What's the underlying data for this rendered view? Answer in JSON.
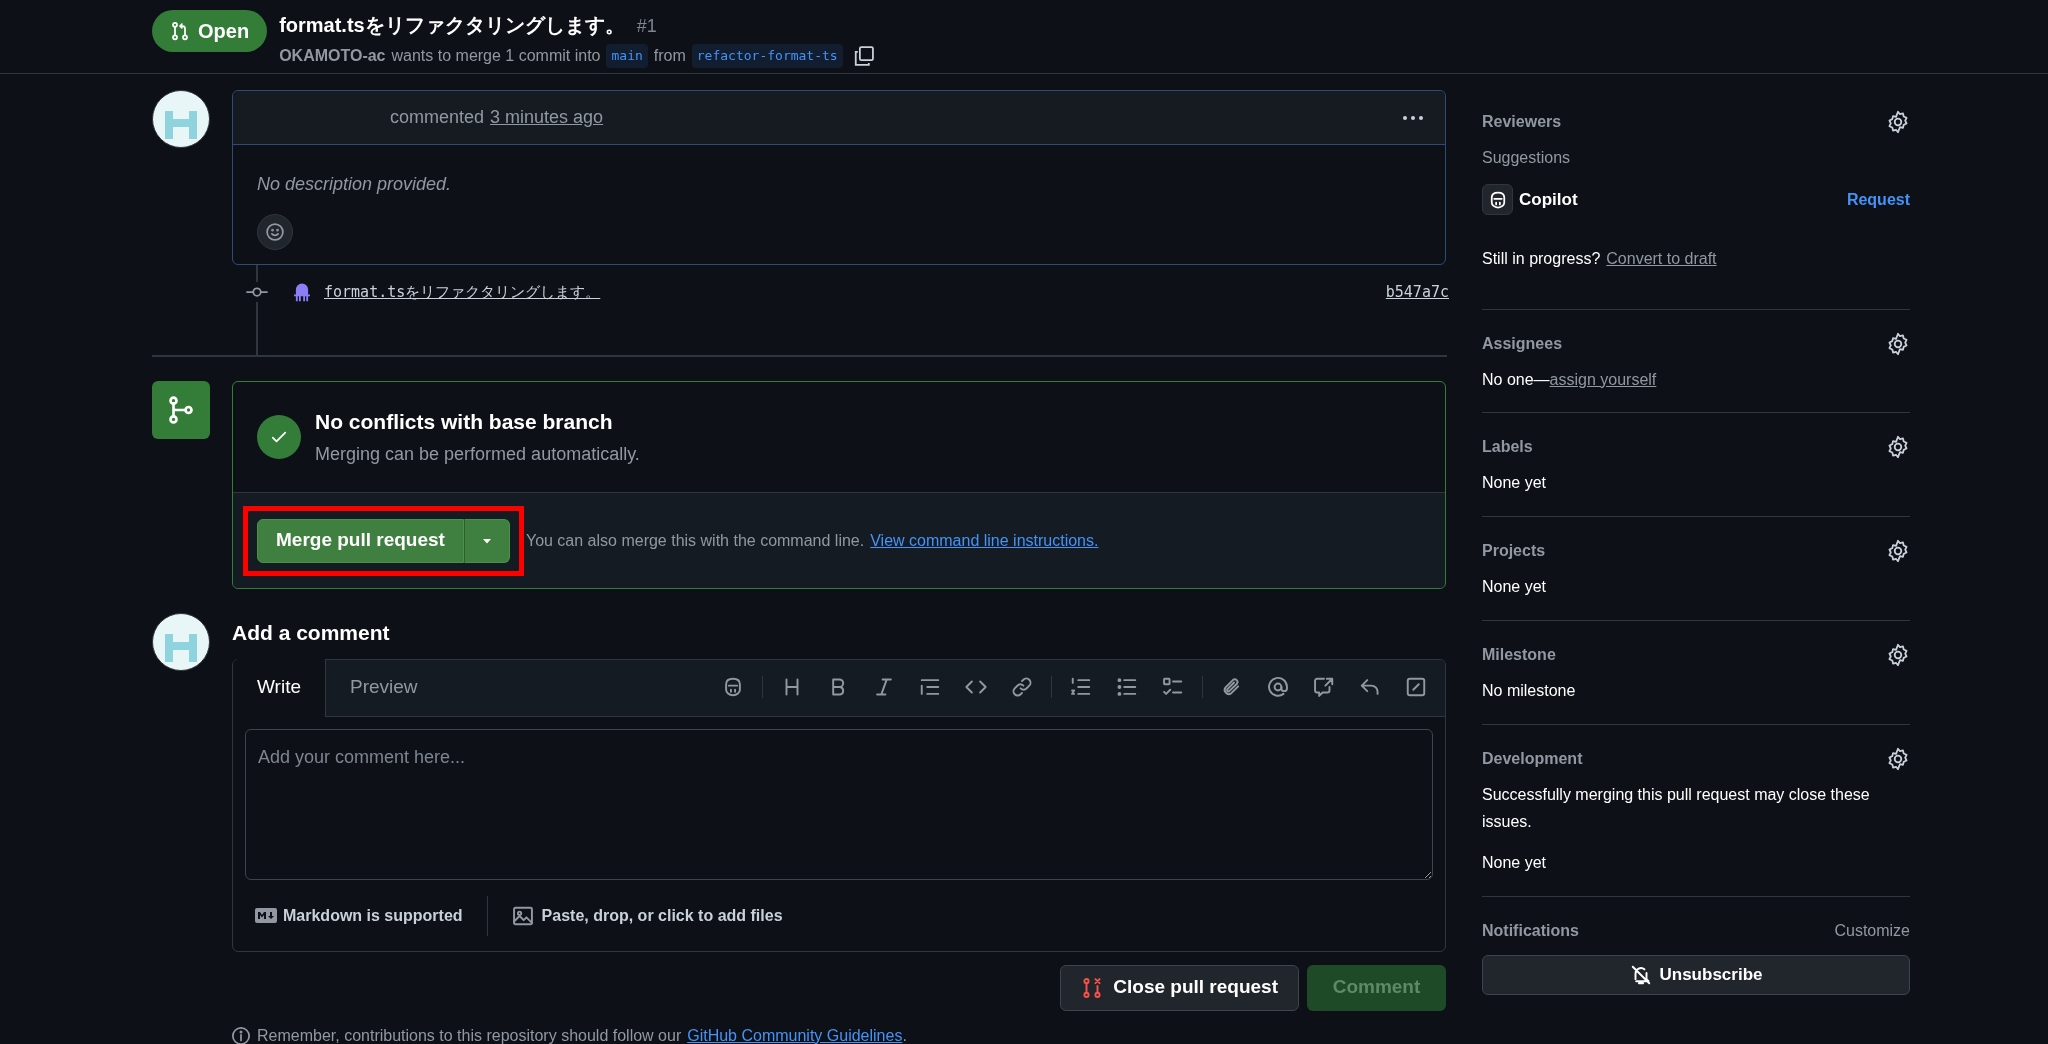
{
  "header": {
    "state": {
      "label": "Open",
      "kind": "open"
    },
    "title": "format.tsをリファクタリングします。",
    "number": "#1",
    "author": "OKAMOTO-ac",
    "merge_text": "wants to merge 1 commit into",
    "base_branch": "main",
    "from_text": "from",
    "head_branch": "refactor-format-ts"
  },
  "comment": {
    "action": "commented",
    "time": "3 minutes ago",
    "body": "No description provided."
  },
  "commit": {
    "message": "format.tsをリファクタリングします。",
    "sha": "b547a7c"
  },
  "merge": {
    "title": "No conflicts with base branch",
    "subtitle": "Merging can be performed automatically.",
    "button": "Merge pull request",
    "hint": "You can also merge this with the command line.",
    "link": "View command line instructions.",
    "highlighted": true
  },
  "add_comment": {
    "heading": "Add a comment",
    "tabs": [
      {
        "label": "Write",
        "selected": true
      },
      {
        "label": "Preview",
        "selected": false
      }
    ],
    "placeholder": "Add your comment here...",
    "markdown_note": "Markdown is supported",
    "files_note": "Paste, drop, or click to add files",
    "close_button": "Close pull request",
    "comment_button": {
      "label": "Comment",
      "disabled": true
    }
  },
  "footnote": {
    "text": "Remember, contributions to this repository should follow our",
    "link": "GitHub Community Guidelines",
    "end": "."
  },
  "sidebar": {
    "reviewers": {
      "title": "Reviewers",
      "suggestions": "Suggestions",
      "suggestion": {
        "name": "Copilot",
        "action": "Request"
      },
      "draft_text": "Still in progress?",
      "draft_link": "Convert to draft"
    },
    "assignees": {
      "title": "Assignees",
      "text": "No one—",
      "link": "assign yourself"
    },
    "sections": [
      {
        "title": "Labels",
        "lines": [
          "None yet"
        ]
      },
      {
        "title": "Projects",
        "lines": [
          "None yet"
        ]
      },
      {
        "title": "Milestone",
        "lines": [
          "No milestone"
        ]
      },
      {
        "title": "Development",
        "lines": [
          "Successfully merging this pull request may close these issues.",
          "None yet"
        ]
      }
    ],
    "notifications": {
      "title": "Notifications",
      "customize": "Customize",
      "button": "Unsubscribe"
    }
  }
}
